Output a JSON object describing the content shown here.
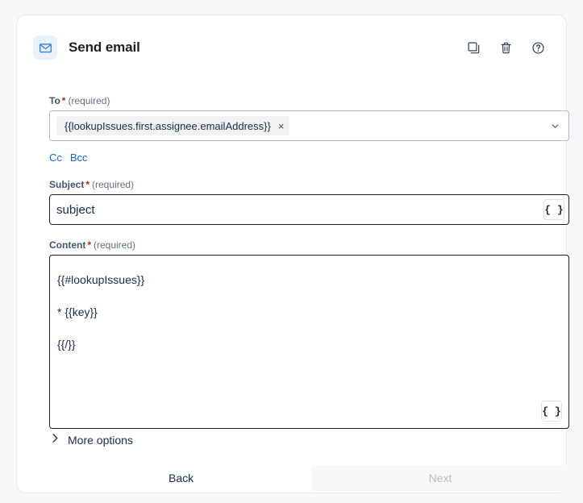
{
  "card": {
    "header": {
      "icon": "envelope-icon",
      "title": "Send email",
      "actions": [
        {
          "name": "duplicate-icon",
          "title": "Duplicate"
        },
        {
          "name": "trash-icon",
          "title": "Delete"
        },
        {
          "name": "help-icon",
          "title": "Help"
        }
      ]
    },
    "fields": {
      "to": {
        "label": "To",
        "required_star": "*",
        "required_text": "(required)",
        "chip_value": "{{lookupIssues.first.assignee.emailAddress}}",
        "chip_remove": "×",
        "chevron": "chevron-down-icon"
      },
      "cc": {
        "label": "Cc"
      },
      "bcc": {
        "label": "Bcc"
      },
      "subject": {
        "label": "Subject",
        "required_star": "*",
        "required_text": "(required)",
        "value": "subject",
        "brace_label": "{ }"
      },
      "content": {
        "label": "Content",
        "required_star": "*",
        "required_text": "(required)",
        "value": "{{#lookupIssues}}\n* {{key}}\n{{/}}",
        "brace_label": "{ }"
      }
    },
    "more_options": {
      "label": "More options",
      "chevron": "chevron-right-icon"
    },
    "footer": {
      "back_label": "Back",
      "next_label": "Next"
    }
  },
  "colors": {
    "page_background": "#f7f8f9",
    "card_background": "#ffffff",
    "accent_link": "#0c66e4",
    "required_star": "#ae2a19",
    "icon_tile": "#e9f0fe",
    "chip_background": "#f1f2f4",
    "disabled_button": "#f7f8f9"
  }
}
